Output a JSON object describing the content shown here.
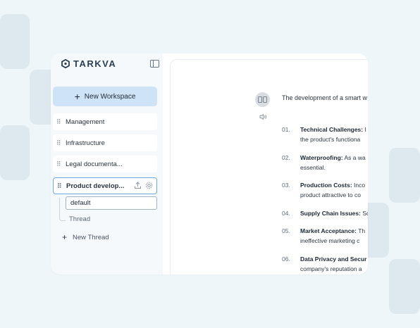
{
  "app": {
    "brand": "TARKVA"
  },
  "sidebar": {
    "new_workspace_label": "New Workspace",
    "workspaces": [
      {
        "label": "Management"
      },
      {
        "label": "Infrastructure"
      },
      {
        "label": "Legal documenta..."
      },
      {
        "label": "Product develop...",
        "active": true
      }
    ],
    "threads": [
      {
        "label": "default",
        "selected": true
      },
      {
        "label": "Thread"
      }
    ],
    "new_thread_label": "New Thread"
  },
  "chat": {
    "intro": "The development of a smart w",
    "items": [
      {
        "num": "01.",
        "title": "Technical Challenges:",
        "line1": " I",
        "line2": "the product's functiona"
      },
      {
        "num": "02.",
        "title": "Waterproofing:",
        "line1": " As a wa",
        "line2": "essential."
      },
      {
        "num": "03.",
        "title": "Production Costs:",
        "line1": " Inco",
        "line2": "product attractive to co"
      },
      {
        "num": "04.",
        "title": "Supply Chain Issues:",
        "line1": " Sc",
        "line2": ""
      },
      {
        "num": "05.",
        "title": "Market Acceptance:",
        "line1": " Th",
        "line2": "ineffective marketing c"
      },
      {
        "num": "06.",
        "title": "Data Privacy and Secur",
        "line1": "",
        "line2": "company's reputation a"
      }
    ]
  },
  "colors": {
    "background": "#eef6fa",
    "accent": "#cfe3f6",
    "active_border": "#6fa7e0"
  }
}
